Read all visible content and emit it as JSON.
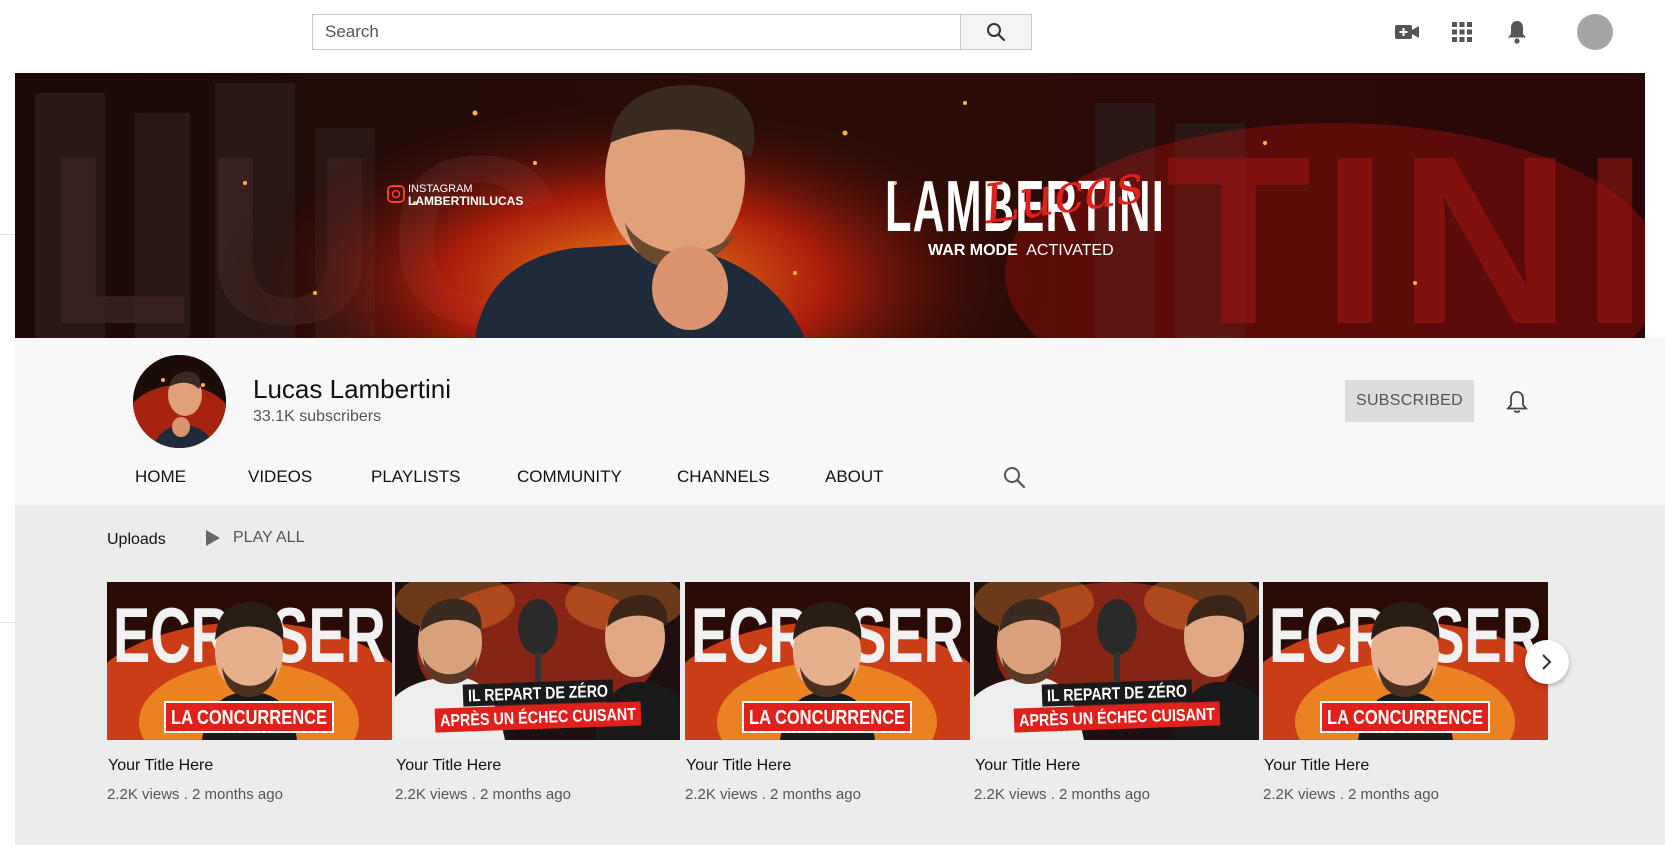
{
  "search": {
    "placeholder": "Search"
  },
  "top_icons": [
    "create-video-icon",
    "apps-grid-icon",
    "notifications-bell-icon",
    "account-avatar"
  ],
  "banner": {
    "instagram_label": "INSTAGRAM",
    "instagram_handle": "LAMBERTINILUCAS",
    "big_name": "LAMBERTINI",
    "script_name": "Lucas",
    "tagline_bold": "WAR MODE",
    "tagline_rest": "ACTIVATED"
  },
  "channel": {
    "name": "Lucas Lambertini",
    "subscribers": "33.1K subscribers",
    "subscribe_label": "SUBSCRIBED"
  },
  "tabs": [
    {
      "label": "HOME"
    },
    {
      "label": "VIDEOS"
    },
    {
      "label": "PLAYLISTS"
    },
    {
      "label": "COMMUNITY"
    },
    {
      "label": "CHANNELS"
    },
    {
      "label": "ABOUT"
    }
  ],
  "uploads": {
    "label": "Uploads",
    "play_all": "PLAY ALL"
  },
  "thumb_texts": {
    "a_big": "ECRASER",
    "a_banner": "LA CONCURRENCE",
    "b_line1": "IL REPART DE ZÉRO",
    "b_line2": "APRÈS UN ÉCHEC CUISANT"
  },
  "videos": [
    {
      "title": "Your Title Here",
      "meta": "2.2K views . 2 months ago",
      "thumb": "A"
    },
    {
      "title": "Your Title Here",
      "meta": "2.2K views . 2 months ago",
      "thumb": "B"
    },
    {
      "title": "Your Title Here",
      "meta": "2.2K views . 2 months ago",
      "thumb": "A"
    },
    {
      "title": "Your Title Here",
      "meta": "2.2K views . 2 months ago",
      "thumb": "B"
    },
    {
      "title": "Your Title Here",
      "meta": "2.2K views . 2 months ago",
      "thumb": "A"
    }
  ],
  "colors": {
    "accent_red": "#e0201b",
    "banner_dark": "#120505",
    "subscribed_bg": "#dcdcdc"
  }
}
